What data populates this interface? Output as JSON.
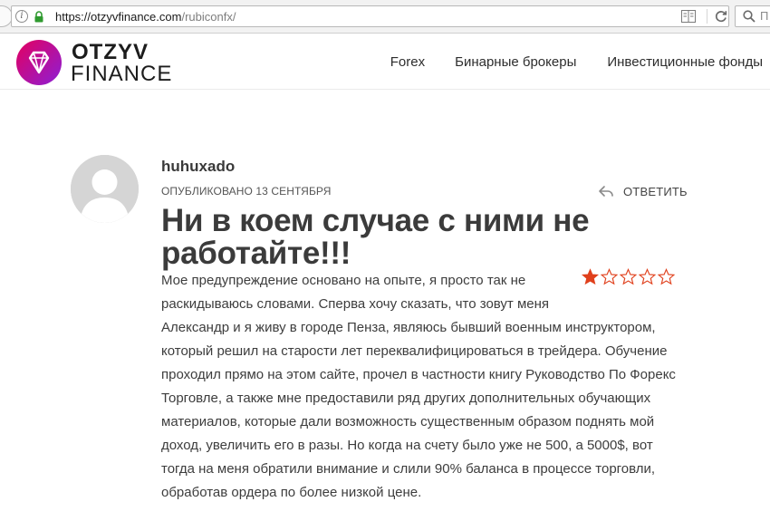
{
  "browser": {
    "url_host": "https://otzyvfinance.com",
    "url_path": "/rubiconfx/",
    "search_placeholder": "П"
  },
  "site": {
    "logo_line1": "OTZYV",
    "logo_line2": "FINANCE",
    "colors": {
      "logo_gradient_start": "#e4005f",
      "logo_gradient_end": "#8c1fd6",
      "star_active": "#e0401c"
    }
  },
  "nav": {
    "items": [
      {
        "label": "Forex"
      },
      {
        "label": "Бинарные брокеры"
      },
      {
        "label": "Инвестиционные фонды"
      }
    ]
  },
  "review": {
    "author": "huhuxado",
    "published": "ОПУБЛИКОВАНО 13 СЕНТЯБРЯ",
    "reply_label": "ОТВЕТИТЬ",
    "title": "Ни в коем случае с ними не работайте!!!",
    "rating": {
      "value": 1,
      "max": 5
    },
    "body_lines": [
      "Мое предупреждение основано на опыте, я просто так не",
      "раскидываюсь словами. Сперва хочу сказать, что зовут меня",
      "Александр и я живу в городе Пенза, являюсь бывший военным инструктором,",
      "который решил на старости лет переквалифицироваться в трейдера. Обучение",
      "проходил прямо на этом сайте, прочел в частности книгу Руководство По Форекс",
      "Торговле, а также мне предоставили ряд других дополнительных обучающих",
      "материалов, которые дали возможность существенным образом поднять мой",
      "доход, увеличить его в разы. Но когда на счету было уже не 500, а 5000$, вот",
      "тогда на меня обратили внимание и слили 90% баланса в процессе торговли,",
      "обработав ордера по более низкой цене."
    ]
  }
}
